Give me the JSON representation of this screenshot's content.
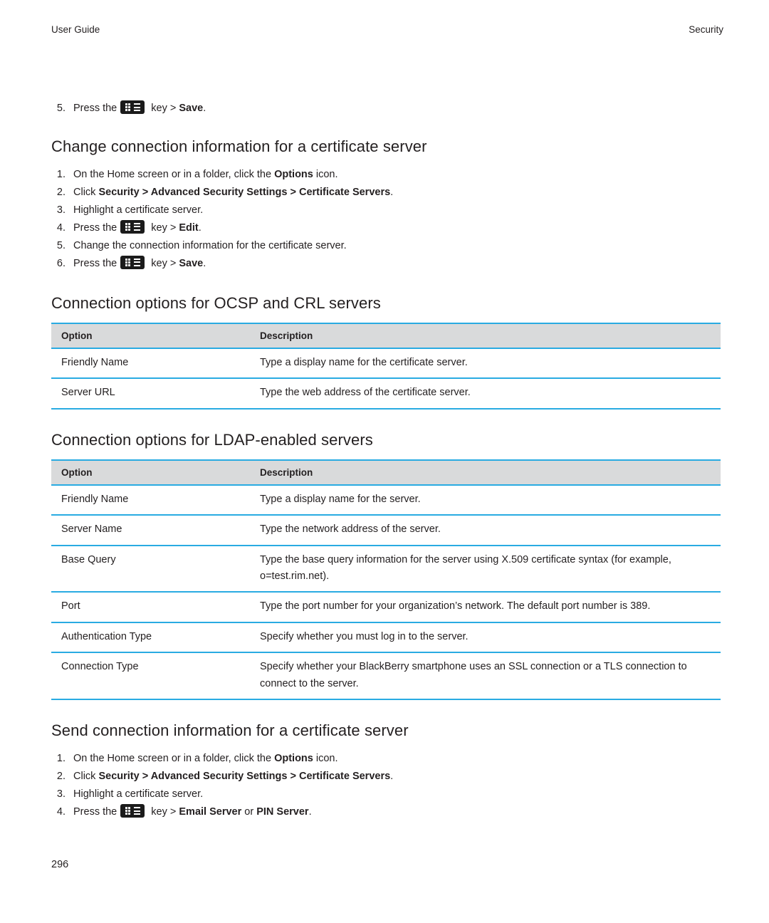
{
  "header": {
    "left": "User Guide",
    "right": "Security"
  },
  "intro_steps": [
    {
      "num": "5.",
      "pre": "Press the",
      "key": true,
      "post_plain": " key > ",
      "post_bold": "Save",
      "tail": "."
    }
  ],
  "sections": [
    {
      "title": "Change connection information for a certificate server",
      "steps": [
        {
          "num": "1.",
          "segments": [
            {
              "text": "On the Home screen or in a folder, click the ",
              "bold": false
            },
            {
              "text": "Options",
              "bold": true
            },
            {
              "text": " icon.",
              "bold": false
            }
          ]
        },
        {
          "num": "2.",
          "segments": [
            {
              "text": "Click ",
              "bold": false
            },
            {
              "text": "Security",
              "bold": true
            },
            {
              "text": " > ",
              "bold": true
            },
            {
              "text": "Advanced Security Settings",
              "bold": true
            },
            {
              "text": " > ",
              "bold": true
            },
            {
              "text": "Certificate Servers",
              "bold": true
            },
            {
              "text": ".",
              "bold": false
            }
          ]
        },
        {
          "num": "3.",
          "segments": [
            {
              "text": "Highlight a certificate server.",
              "bold": false
            }
          ]
        },
        {
          "num": "4.",
          "key": true,
          "segments_before": [
            {
              "text": "Press the",
              "bold": false
            }
          ],
          "segments_after": [
            {
              "text": " key > ",
              "bold": false
            },
            {
              "text": "Edit",
              "bold": true
            },
            {
              "text": ".",
              "bold": false
            }
          ]
        },
        {
          "num": "5.",
          "segments": [
            {
              "text": "Change the connection information for the certificate server.",
              "bold": false
            }
          ]
        },
        {
          "num": "6.",
          "key": true,
          "segments_before": [
            {
              "text": "Press the",
              "bold": false
            }
          ],
          "segments_after": [
            {
              "text": " key > ",
              "bold": false
            },
            {
              "text": "Save",
              "bold": true
            },
            {
              "text": ".",
              "bold": false
            }
          ]
        }
      ]
    },
    {
      "title": "Connection options for OCSP and CRL servers",
      "table": {
        "headers": [
          "Option",
          "Description"
        ],
        "rows": [
          [
            "Friendly Name",
            "Type a display name for the certificate server."
          ],
          [
            "Server URL",
            "Type the web address of the certificate server."
          ]
        ]
      }
    },
    {
      "title": "Connection options for LDAP-enabled servers",
      "table": {
        "headers": [
          "Option",
          "Description"
        ],
        "rows": [
          [
            "Friendly Name",
            "Type a display name for the server."
          ],
          [
            "Server Name",
            "Type the network address of the server."
          ],
          [
            "Base Query",
            "Type the base query information for the server using X.509 certificate syntax (for example, o=test.rim.net)."
          ],
          [
            "Port",
            "Type the port number for your organization’s network. The default port number is 389."
          ],
          [
            "Authentication Type",
            "Specify whether you must log in to the server."
          ],
          [
            "Connection Type",
            "Specify whether your BlackBerry smartphone uses an SSL connection or a TLS connection to connect to the server."
          ]
        ]
      }
    },
    {
      "title": "Send connection information for a certificate server",
      "steps": [
        {
          "num": "1.",
          "segments": [
            {
              "text": "On the Home screen or in a folder, click the ",
              "bold": false
            },
            {
              "text": "Options",
              "bold": true
            },
            {
              "text": " icon.",
              "bold": false
            }
          ]
        },
        {
          "num": "2.",
          "segments": [
            {
              "text": "Click ",
              "bold": false
            },
            {
              "text": "Security",
              "bold": true
            },
            {
              "text": " > ",
              "bold": true
            },
            {
              "text": "Advanced Security Settings",
              "bold": true
            },
            {
              "text": " > ",
              "bold": true
            },
            {
              "text": "Certificate Servers",
              "bold": true
            },
            {
              "text": ".",
              "bold": false
            }
          ]
        },
        {
          "num": "3.",
          "segments": [
            {
              "text": "Highlight a certificate server.",
              "bold": false
            }
          ]
        },
        {
          "num": "4.",
          "key": true,
          "segments_before": [
            {
              "text": "Press the",
              "bold": false
            }
          ],
          "segments_after": [
            {
              "text": " key > ",
              "bold": false
            },
            {
              "text": "Email Server",
              "bold": true
            },
            {
              "text": " or ",
              "bold": false
            },
            {
              "text": "PIN Server",
              "bold": true
            },
            {
              "text": ".",
              "bold": false
            }
          ]
        }
      ]
    }
  ],
  "footer": {
    "page_number": "296"
  }
}
